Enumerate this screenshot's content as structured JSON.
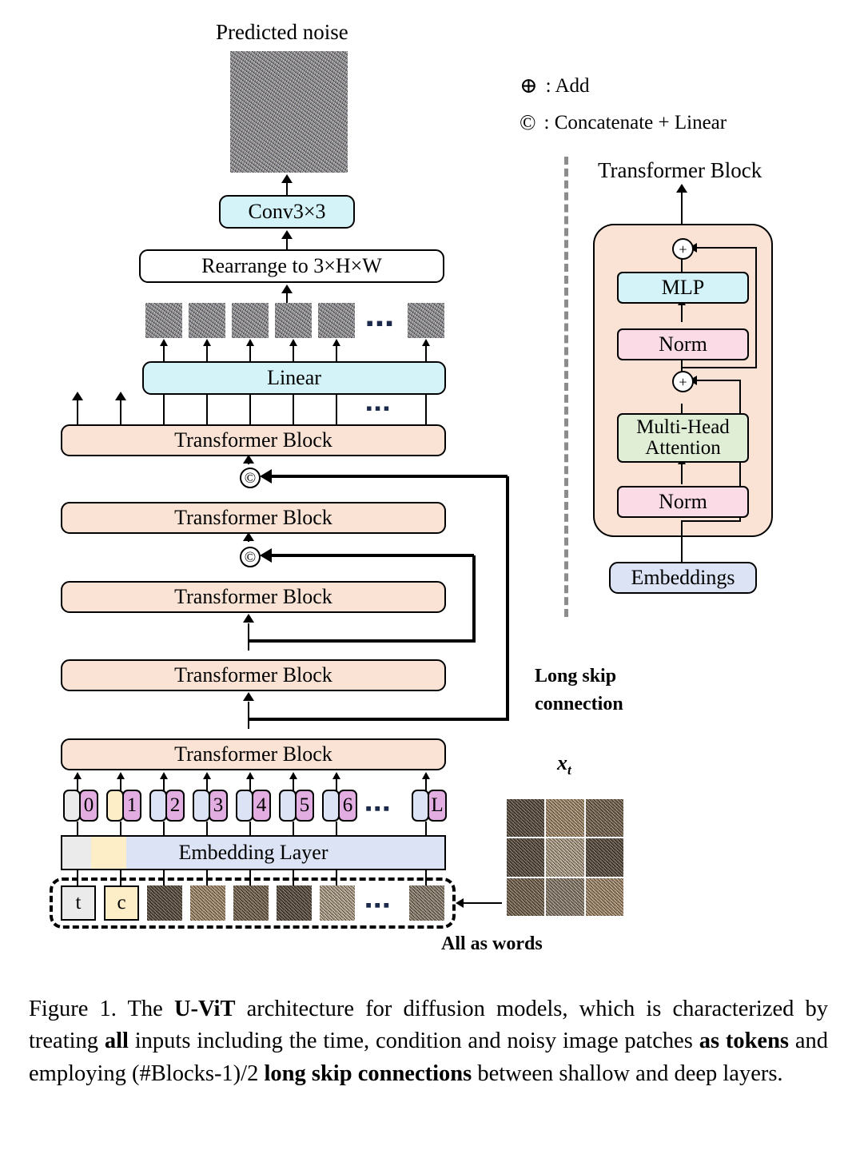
{
  "figure": {
    "title_top": "Predicted noise",
    "legend": [
      {
        "symbol": "⊕",
        "text": ": Add",
        "name": "add"
      },
      {
        "symbol": "©",
        "text": ": Concatenate + Linear",
        "name": "concat-linear"
      }
    ],
    "left_column": {
      "conv_label": "Conv3×3",
      "rearrange_label": "Rearrange to 3×H×W",
      "linear_label": "Linear",
      "transformer_block_label": "Transformer Block",
      "transformer_block_count": 5,
      "embedding_layer_label": "Embedding Layer",
      "concat_symbol": "©",
      "ellipsis": "▪▪▪",
      "tokens": [
        "0",
        "1",
        "2",
        "3",
        "4",
        "5",
        "6",
        "L"
      ],
      "input_tokens": [
        "t",
        "c"
      ],
      "skip_label_line1": "Long skip",
      "skip_label_line2": "connection",
      "all_as_words_label": "All as words"
    },
    "right_column": {
      "panel_title": "Transformer Block",
      "xt_label": "x",
      "xt_sub": "t",
      "blocks": [
        {
          "name": "mlp",
          "label": "MLP",
          "color": "#d3f3f8"
        },
        {
          "name": "norm-upper",
          "label": "Norm",
          "color": "#fadbe6"
        },
        {
          "name": "multi-head-attention",
          "label": "Multi-Head\nAttention",
          "label_line1": "Multi-Head",
          "label_line2": "Attention",
          "color": "#e0eed6"
        },
        {
          "name": "norm-lower",
          "label": "Norm",
          "color": "#fadbe6"
        }
      ],
      "embeddings_label": "Embeddings",
      "add_symbol": "+"
    },
    "colors": {
      "peach": "#fae3d4",
      "cyan": "#d3f3f8",
      "pink": "#fadbe6",
      "green": "#e0eed6",
      "lavender": "#dbe3f5",
      "gray": "#ebebeb",
      "yellow": "#fdeec8",
      "magenta": "#e2ade0",
      "divider_gray": "#8c8c8c"
    }
  },
  "caption": {
    "p1": "Figure 1.  The ",
    "b1": "U-ViT",
    "p2": " architecture for diffusion models, which is characterized by treating ",
    "b2": "all",
    "p3": " inputs including the time, condition and noisy image patches ",
    "b3": "as tokens",
    "p4": " and employing (#Blocks-1)/2 ",
    "b4": "long skip connections",
    "p5": " between shallow and deep layers."
  }
}
